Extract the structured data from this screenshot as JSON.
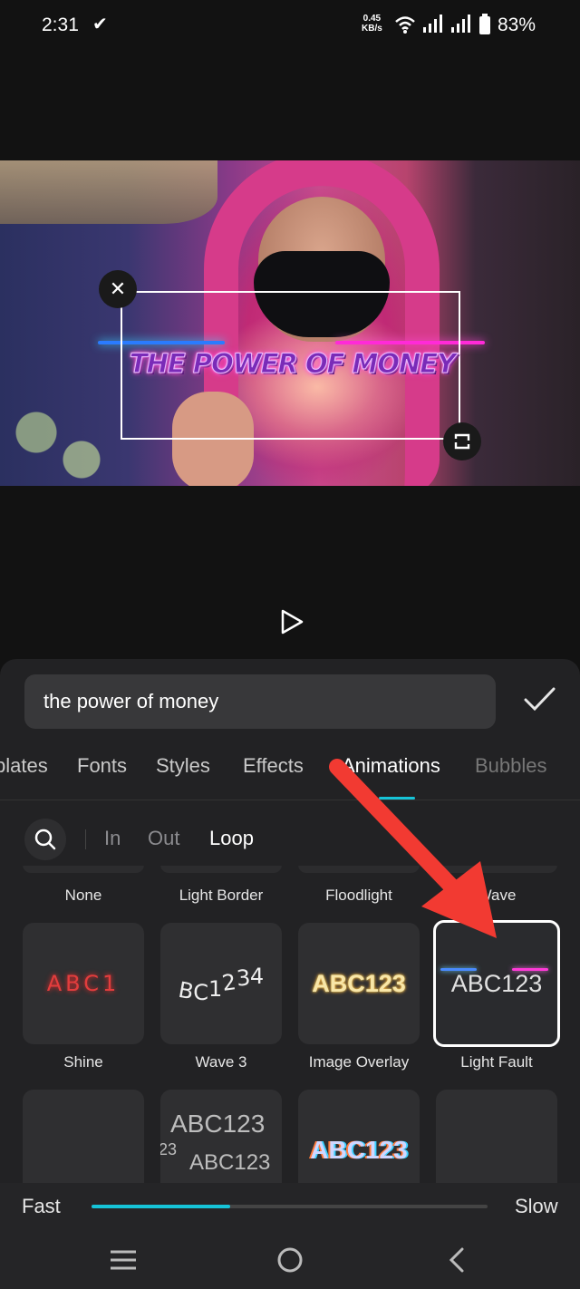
{
  "status_bar": {
    "time": "2:31",
    "net_speed_value": "0.45",
    "net_speed_unit": "KB/s",
    "battery": "83%"
  },
  "preview": {
    "overlay_text": "THE POWER OF MONEY"
  },
  "editor": {
    "text_value": "the power of money"
  },
  "tabs": [
    {
      "label": "plates"
    },
    {
      "label": "Fonts"
    },
    {
      "label": "Styles"
    },
    {
      "label": "Effects"
    },
    {
      "label": "Animations"
    },
    {
      "label": "Bubbles"
    }
  ],
  "anim_filters": {
    "in": "In",
    "out": "Out",
    "loop": "Loop"
  },
  "animations_row0": [
    "None",
    "Light Border",
    "Floodlight",
    "Wave"
  ],
  "animations_row1": [
    {
      "label": "Shine",
      "preview": "ABC1"
    },
    {
      "label": "Wave 3",
      "preview": "BC1234"
    },
    {
      "label": "Image Overlay",
      "preview": "ABC123"
    },
    {
      "label": "Light Fault",
      "preview": "ABC123"
    }
  ],
  "animations_row2": [
    {
      "preview_a": "ABC123",
      "preview_b": "ABC123",
      "preview_c": "23"
    },
    {
      "preview": "ABC123"
    }
  ],
  "speed": {
    "fast_label": "Fast",
    "slow_label": "Slow",
    "value": 0.35
  },
  "colors": {
    "accent": "#16c4d8",
    "annotation_arrow": "#f23a32"
  }
}
